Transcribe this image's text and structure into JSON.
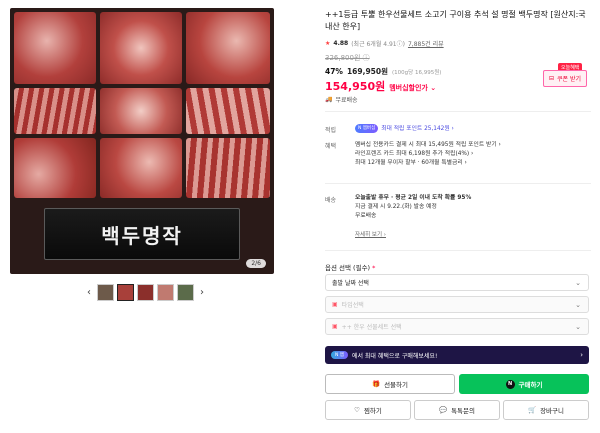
{
  "gallery": {
    "nameplate_text": "백두명작",
    "image_counter": "2/6",
    "thumb_prev": "‹",
    "thumb_next": "›"
  },
  "product": {
    "title": "++1등급 투뿔 한우선물세트 소고기 구이용 추석 설 명절 백두명작 [원산지:국내산 한우]",
    "rating_star": "★",
    "rating_score": "4.88",
    "rating_sub": "(최근 6개월 4.91ⓘ)",
    "review_count": "7,885건 리뷰",
    "original_price": "326,800원 ⓘ",
    "discount_rate": "47%",
    "sale_price": "169,950원",
    "unit_price": "(100g당 16,995원)",
    "member_price": "154,950원",
    "member_label": "멤버십할인가 ⌄",
    "free_shipping": "무료배송",
    "today_badge": "오늘혜택",
    "coupon_label": "쿠폰 받기"
  },
  "benefits": {
    "points_label": "적립",
    "points_badge": "N 멤버십",
    "points_text": "최대 적립 포인트 25,142원 ›",
    "card_label": "혜택",
    "card_lines": [
      "멤버십 전용카드 결제 시 최대 15,495원 적립 포인트 받기 ›",
      "라인프렌즈 카드 최대 6,198원 추가 적립(4%) ›",
      "최대 12개월 무이자 할부 · 60개월 특별금리 ›"
    ],
    "delivery_label": "배송",
    "delivery_lines": [
      "오늘출발 휴무 · 평균 2일 이내 도착 확률 95%",
      "지금 결제 시 9.22.(화) 발송 예정",
      "무료배송"
    ],
    "more_link": "자세히 보기 ›"
  },
  "options": {
    "title": "옵션 선택 (필수)",
    "required_mark": "*",
    "select1": "출발 날짜 선택",
    "select2": "타입선택",
    "select3": "++ 한우 선물세트 선택",
    "chevron": "⌄"
  },
  "promo": {
    "pill": "N 앱",
    "text": "에서 최대 혜택으로 구매해보세요!",
    "arrow": "›"
  },
  "actions": {
    "gift": "선물하기",
    "buy": "구매하기",
    "wish": "찜하기",
    "talk": "톡톡문의",
    "cart": "장바구니"
  },
  "colors": {
    "accent_red": "#ff0044",
    "buy_green": "#07c25a",
    "promo_bg": "#1e1545"
  }
}
